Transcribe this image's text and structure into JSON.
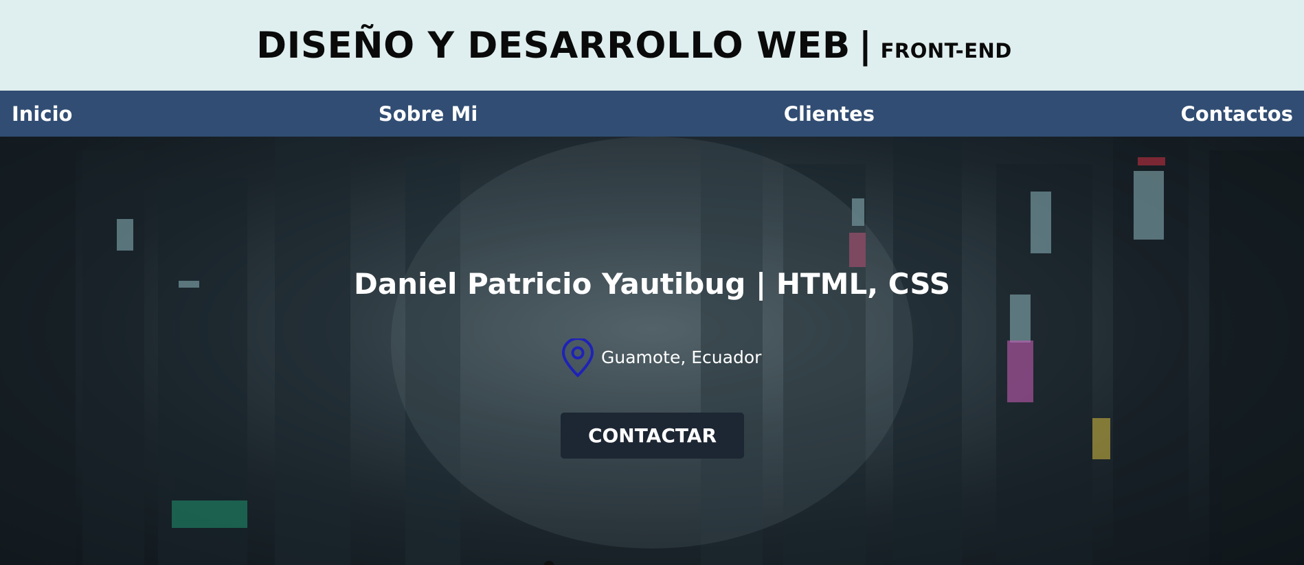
{
  "header": {
    "title": "DISEÑO Y DESARROLLO WEB",
    "separator": "|",
    "subtitle": "FRONT-END"
  },
  "nav": {
    "items": [
      {
        "label": "Inicio"
      },
      {
        "label": "Sobre Mi"
      },
      {
        "label": "Clientes"
      },
      {
        "label": "Contactos"
      }
    ]
  },
  "hero": {
    "heading": "Daniel Patricio Yautibug | HTML, CSS",
    "location": "Guamote, Ecuador",
    "location_icon": "map-pin-icon",
    "location_icon_color": "#1e22b8",
    "button_label": "CONTACTAR",
    "button_color": "#1d2633"
  },
  "colors": {
    "header_bg": "#dfeeee",
    "nav_bg": "#314d73"
  }
}
